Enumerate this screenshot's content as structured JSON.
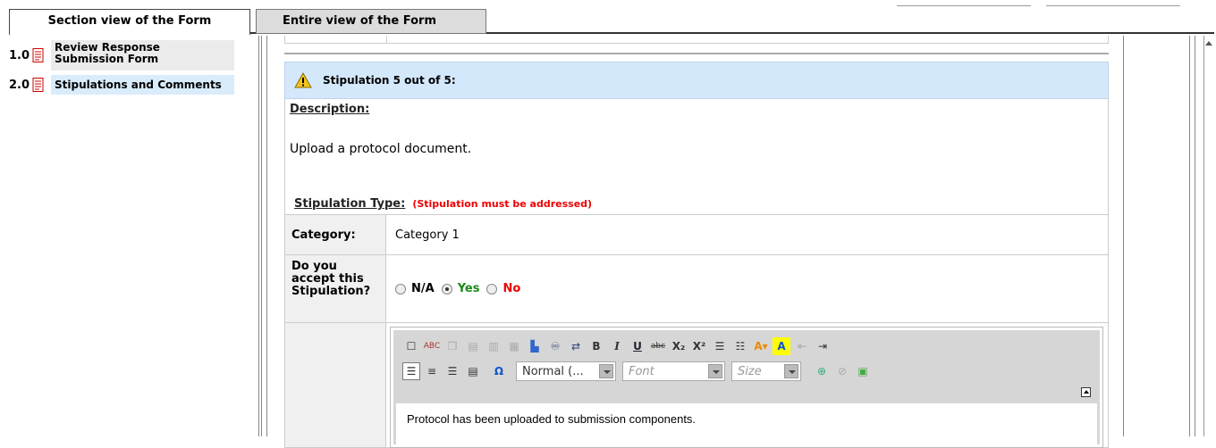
{
  "tabs": [
    {
      "label": "Section view of the Form",
      "active": true
    },
    {
      "label": "Entire view of the Form",
      "active": false
    }
  ],
  "nav": {
    "items": [
      {
        "number": "1.0",
        "label": "Review Response Submission Form"
      },
      {
        "number": "2.0",
        "label": "Stipulations and Comments"
      }
    ]
  },
  "stipulation": {
    "header": "Stipulation 5 out of 5:",
    "description_label": "Description:",
    "description_text": "Upload a protocol document.",
    "type_label": "Stipulation Type:",
    "type_value": "(Stipulation must be addressed)",
    "category_label": "Category:",
    "category_value": "Category 1",
    "accept_label": "Do you accept this Stipulation?",
    "options": {
      "na": "N/A",
      "yes": "Yes",
      "no": "No"
    },
    "selected": "Yes"
  },
  "editor": {
    "format_combo": "Normal (...",
    "font_combo": "Font",
    "size_combo": "Size",
    "content": "Protocol has been uploaded to submission components."
  },
  "colors": {
    "header_bg": "#d4e8fc",
    "required_red": "#ee0000",
    "yes_green": "#1a8a1a"
  }
}
